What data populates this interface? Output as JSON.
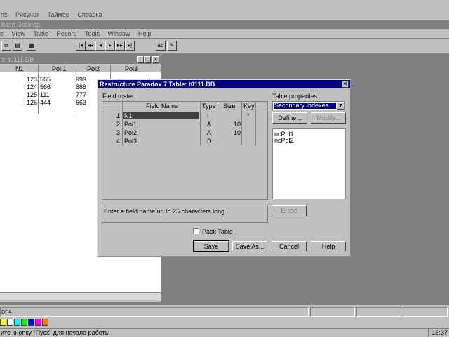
{
  "app": {
    "menu_top": [
      "ns",
      "Рисунок",
      "Таймер",
      "Справка"
    ],
    "main_title": "base Desktop",
    "menu": [
      "e",
      "View",
      "Table",
      "Record",
      "Tools",
      "Window",
      "Help"
    ]
  },
  "table_window": {
    "title": "e: t0111.DB",
    "headers": [
      "N1",
      "Pol 1",
      "Pol2",
      "Pol3"
    ],
    "rows": [
      {
        "n1": "123",
        "p1": "565",
        "p2": "999"
      },
      {
        "n1": "124",
        "p1": "566",
        "p2": "888"
      },
      {
        "n1": "125",
        "p1": "111",
        "p2": "777"
      },
      {
        "n1": "126",
        "p1": "444",
        "p2": "663"
      }
    ]
  },
  "dialog": {
    "title": "Restructure Paradox 7 Table: t0111.DB",
    "field_roster_label": "Field roster:",
    "col_headers": [
      "Field Name",
      "Type",
      "Size",
      "Key"
    ],
    "fields": [
      {
        "num": "1",
        "name": "N1",
        "type": "I",
        "size": "",
        "key": "*"
      },
      {
        "num": "2",
        "name": "Pol1",
        "type": "A",
        "size": "10",
        "key": ""
      },
      {
        "num": "3",
        "name": "Pol2",
        "type": "A",
        "size": "10",
        "key": ""
      },
      {
        "num": "4",
        "name": "Pol3",
        "type": "D",
        "size": "",
        "key": ""
      }
    ],
    "table_properties_label": "Table properties:",
    "table_properties_value": "Secondary Indexes",
    "define_label": "Define...",
    "modify_label": "Modify...",
    "index_list": [
      "ncPol1",
      "ncPol2"
    ],
    "hint": "Enter a field name up to 25 characters long.",
    "erase_label": "Erase",
    "pack_table_label": "Pack Table",
    "save_label": "Save",
    "save_as_label": "Save As...",
    "cancel_label": "Cancel",
    "help_label": "Help"
  },
  "status": {
    "record_info": "of 4",
    "bottom_text": "ите кнопку \"Пуск\" для начала работы",
    "tray": "15:37"
  },
  "palette": [
    "#ffff00",
    "#ffffff",
    "#00ffff",
    "#00ff00",
    "#0000ff",
    "#ff00ff",
    "#ff8000"
  ],
  "colors": {
    "title_active": "#000080",
    "title_inactive": "#808080",
    "selection": "#000080"
  }
}
